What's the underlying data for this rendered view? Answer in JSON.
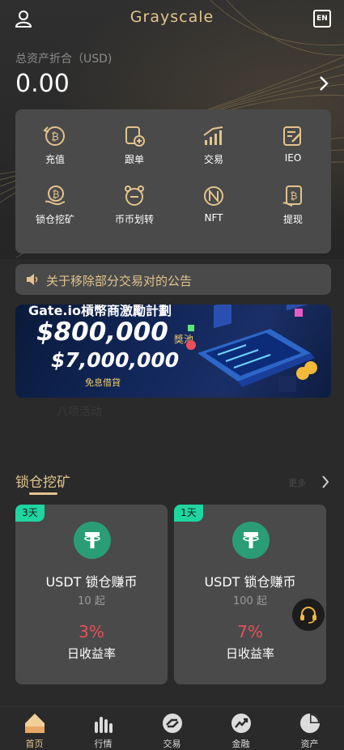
{
  "header": {
    "title": "Grayscale",
    "lang_badge": "EN"
  },
  "assets": {
    "label": "总资产折合（USD)",
    "value": "0.00"
  },
  "menu": [
    {
      "label": "充值",
      "icon": "deposit-icon"
    },
    {
      "label": "跟单",
      "icon": "copy-trade-icon"
    },
    {
      "label": "交易",
      "icon": "trade-icon"
    },
    {
      "label": "IEO",
      "icon": "ieo-icon"
    },
    {
      "label": "锁仓挖矿",
      "icon": "lock-mining-icon"
    },
    {
      "label": "币币划转",
      "icon": "transfer-icon"
    },
    {
      "label": "NFT",
      "icon": "nft-icon"
    },
    {
      "label": "提现",
      "icon": "withdraw-icon"
    }
  ],
  "notice": {
    "text": "关于移除部分交易对的公告"
  },
  "banner": {
    "headline": "Gate.io槓幣商激勵計劃",
    "amount1": "$800,000",
    "amount1_sub": "獎池",
    "amount2": "$7,000,000",
    "amount2_sub": "免息借貸",
    "ghost_text": "八项活动"
  },
  "section": {
    "title": "锁仓挖矿",
    "more": "更多"
  },
  "products": [
    {
      "badge": "3天",
      "name": "USDT 锁仓赚币",
      "min": "10 起",
      "rate": "3%",
      "rate_label": "日收益率"
    },
    {
      "badge": "1天",
      "name": "USDT 锁仓赚币",
      "min": "100 起",
      "rate": "7%",
      "rate_label": "日收益率"
    }
  ],
  "nav": [
    {
      "label": "首页",
      "icon": "home-icon",
      "active": true
    },
    {
      "label": "行情",
      "icon": "market-icon",
      "active": false
    },
    {
      "label": "交易",
      "icon": "trade-icon",
      "active": false
    },
    {
      "label": "金融",
      "icon": "finance-icon",
      "active": false
    },
    {
      "label": "资产",
      "icon": "assets-icon",
      "active": false
    }
  ],
  "colors": {
    "accent": "#e2c48e",
    "positive": "#1fd5a2",
    "rate": "#e8505a",
    "card": "#4a4a4a",
    "background": "#2a2a2a"
  }
}
